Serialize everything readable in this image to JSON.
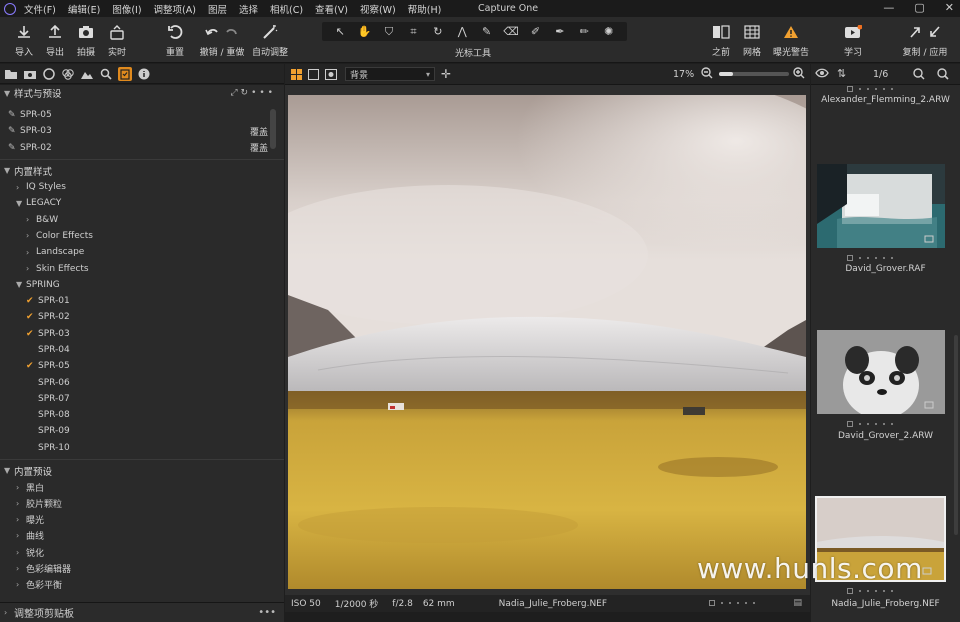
{
  "menu": {
    "items": [
      "文件(F)",
      "编辑(E)",
      "图像(I)",
      "调整项(A)",
      "图层",
      "选择",
      "相机(C)",
      "查看(V)",
      "视察(W)",
      "帮助(H)"
    ],
    "app_title": "Capture One",
    "min": "—",
    "max": "▢",
    "close": "✕"
  },
  "toolbar": {
    "import": "导入",
    "export": "导出",
    "capture": "拍摄",
    "live": "实时",
    "reset": "重置",
    "undo_redo": "撤销 / 重做",
    "auto_adjust": "自动调整",
    "cursor_tools": "光标工具",
    "before": "之前",
    "grid": "网格",
    "exposure_warning": "曝光警告",
    "learn": "学习",
    "copy_apply": "复制 / 应用"
  },
  "colors": {
    "accent": "#e08a1e",
    "panel": "#2a2a2a",
    "warning": "#f0a030"
  },
  "left_panel": {
    "section_styles": "样式与预设",
    "user_styles": [
      {
        "label": "SPR-05",
        "right": ""
      },
      {
        "label": "SPR-03",
        "right": "覆盖"
      },
      {
        "label": "SPR-02",
        "right": "覆盖"
      }
    ],
    "builtin_styles": "内置样式",
    "iq_styles": "IQ Styles",
    "legacy": "LEGACY",
    "legacy_items": [
      "B&W",
      "Color Effects",
      "Landscape",
      "Skin Effects"
    ],
    "spring": "SPRING",
    "spring_items": [
      {
        "label": "SPR-01",
        "checked": "✔"
      },
      {
        "label": "SPR-02",
        "checked": "✔"
      },
      {
        "label": "SPR-03",
        "checked": "✔"
      },
      {
        "label": "SPR-04",
        "checked": ""
      },
      {
        "label": "SPR-05",
        "checked": "✔"
      },
      {
        "label": "SPR-06",
        "checked": ""
      },
      {
        "label": "SPR-07",
        "checked": ""
      },
      {
        "label": "SPR-08",
        "checked": ""
      },
      {
        "label": "SPR-09",
        "checked": ""
      },
      {
        "label": "SPR-10",
        "checked": ""
      }
    ],
    "builtin_presets": "内置预设",
    "preset_items": [
      "黑白",
      "胶片颗粒",
      "曝光",
      "曲线",
      "锐化",
      "色彩编辑器",
      "色彩平衡"
    ],
    "bottom": "调整项剪贴板",
    "more": "•••"
  },
  "viewer": {
    "layer": "背景",
    "zoom": "17%",
    "iso": "ISO 50",
    "shutter": "1/2000 秒",
    "aperture": "f/2.8",
    "focal": "62 mm",
    "filename": "Nadia_Julie_Froberg.NEF"
  },
  "browser": {
    "count": "1/6",
    "thumbs": [
      "Alexander_Flemming_2.ARW",
      "David_Grover.RAF",
      "David_Grover_2.ARW",
      "Nadia_Julie_Froberg.NEF"
    ]
  },
  "watermark": "www.hunls.com"
}
